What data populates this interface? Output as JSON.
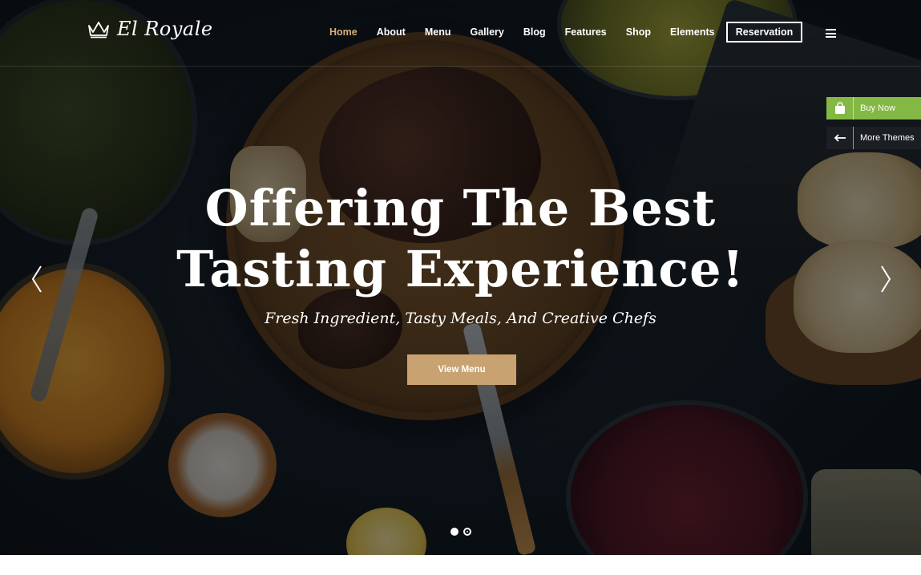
{
  "logo": {
    "text": "El Royale",
    "icon": "crown-icon"
  },
  "nav": {
    "items": [
      {
        "label": "Home",
        "active": true
      },
      {
        "label": "About",
        "active": false
      },
      {
        "label": "Menu",
        "active": false
      },
      {
        "label": "Gallery",
        "active": false
      },
      {
        "label": "Blog",
        "active": false
      },
      {
        "label": "Features",
        "active": false
      },
      {
        "label": "Shop",
        "active": false
      },
      {
        "label": "Elements",
        "active": false
      }
    ],
    "reservation_label": "Reservation",
    "menu_icon": "hamburger-icon"
  },
  "hero": {
    "title_line1": "Offering The Best",
    "title_line2": "Tasting Experience!",
    "subtitle": "Fresh Ingredient, Tasty Meals, And Creative Chefs",
    "button_label": "View Menu",
    "prev_icon": "chevron-left-icon",
    "next_icon": "chevron-right-icon",
    "slides": 2,
    "active_slide": 1
  },
  "side_widgets": {
    "buy_now_label": "Buy Now",
    "buy_now_icon": "shopping-bag-icon",
    "more_themes_label": "More Themes",
    "more_themes_icon": "arrow-left-icon"
  },
  "colors": {
    "accent": "#c9a271",
    "nav_active": "#d6b27a",
    "buy_now": "#83b844",
    "more_themes": "#1b1f23"
  }
}
